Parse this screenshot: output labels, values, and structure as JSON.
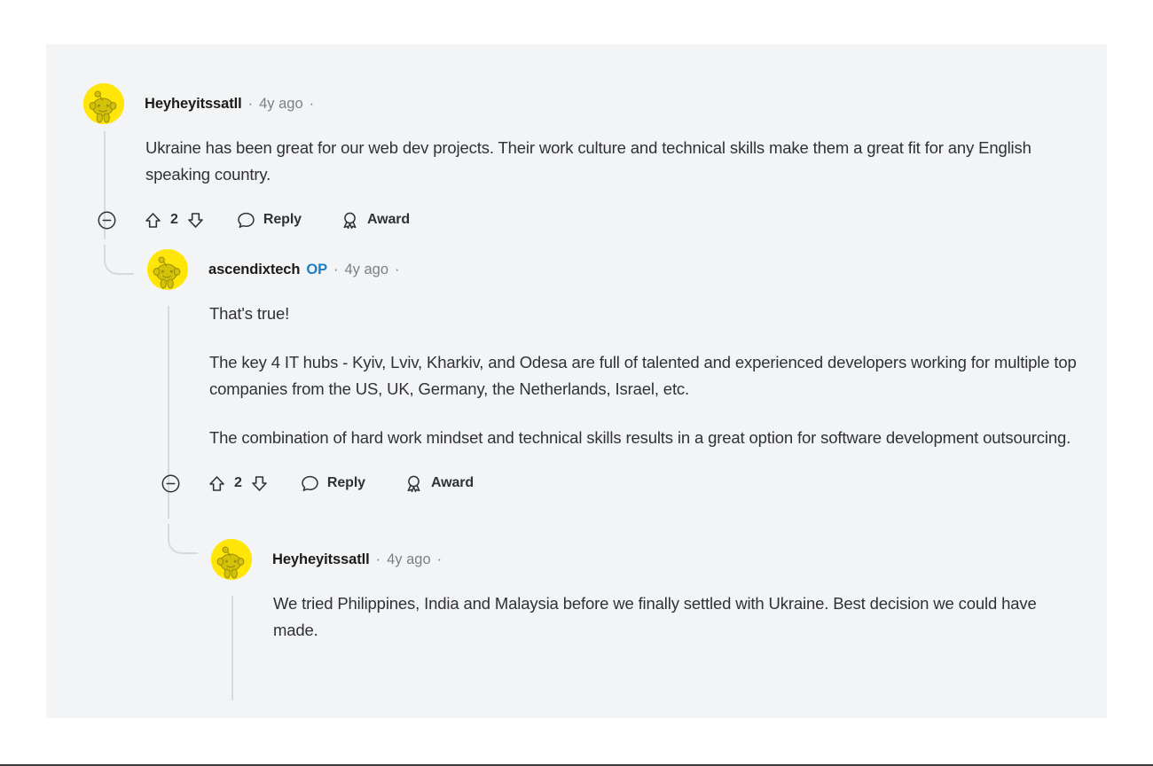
{
  "theme": {
    "panel_bg": "#f3f4f6",
    "page_bg": "#ffffff",
    "avatar_yellow": "#ffe608",
    "op_blue": "#1c7fc4",
    "text_primary": "#2f3133",
    "text_muted": "#7c7f83",
    "thread_line": "#d7dadd"
  },
  "comments": [
    {
      "author": "Heyheyitssatll",
      "op": false,
      "op_label": "",
      "separator": "·",
      "timestamp": "4y ago",
      "trailing_separator": "·",
      "avatar_icon": "reddit-snoo-avatar",
      "paragraphs": [
        "Ukraine has been great for our web dev projects. Their work culture and technical skills make them a great fit for any English speaking country."
      ],
      "actions": {
        "collapse_icon": "collapse-minus-circle-icon",
        "upvote_icon": "upvote-arrow-icon",
        "vote_count": "2",
        "downvote_icon": "downvote-arrow-icon",
        "reply_icon": "comment-bubble-icon",
        "reply_label": "Reply",
        "award_icon": "award-medal-icon",
        "award_label": "Award"
      }
    },
    {
      "author": "ascendixtech",
      "op": true,
      "op_label": "OP",
      "separator": "·",
      "timestamp": "4y ago",
      "trailing_separator": "·",
      "avatar_icon": "reddit-snoo-avatar",
      "paragraphs": [
        "That's true!",
        "The key 4 IT hubs - Kyiv, Lviv, Kharkiv, and Odesa are full of talented and experienced developers working for multiple top companies from the US, UK, Germany, the Netherlands, Israel, etc.",
        "The combination of hard work mindset and technical skills results in a great option for software development outsourcing."
      ],
      "actions": {
        "collapse_icon": "collapse-minus-circle-icon",
        "upvote_icon": "upvote-arrow-icon",
        "vote_count": "2",
        "downvote_icon": "downvote-arrow-icon",
        "reply_icon": "comment-bubble-icon",
        "reply_label": "Reply",
        "award_icon": "award-medal-icon",
        "award_label": "Award"
      }
    },
    {
      "author": "Heyheyitssatll",
      "op": false,
      "op_label": "",
      "separator": "·",
      "timestamp": "4y ago",
      "trailing_separator": "·",
      "avatar_icon": "reddit-snoo-avatar",
      "paragraphs": [
        "We tried Philippines, India and Malaysia before we finally settled with Ukraine. Best decision we could have made."
      ],
      "actions": null
    }
  ]
}
